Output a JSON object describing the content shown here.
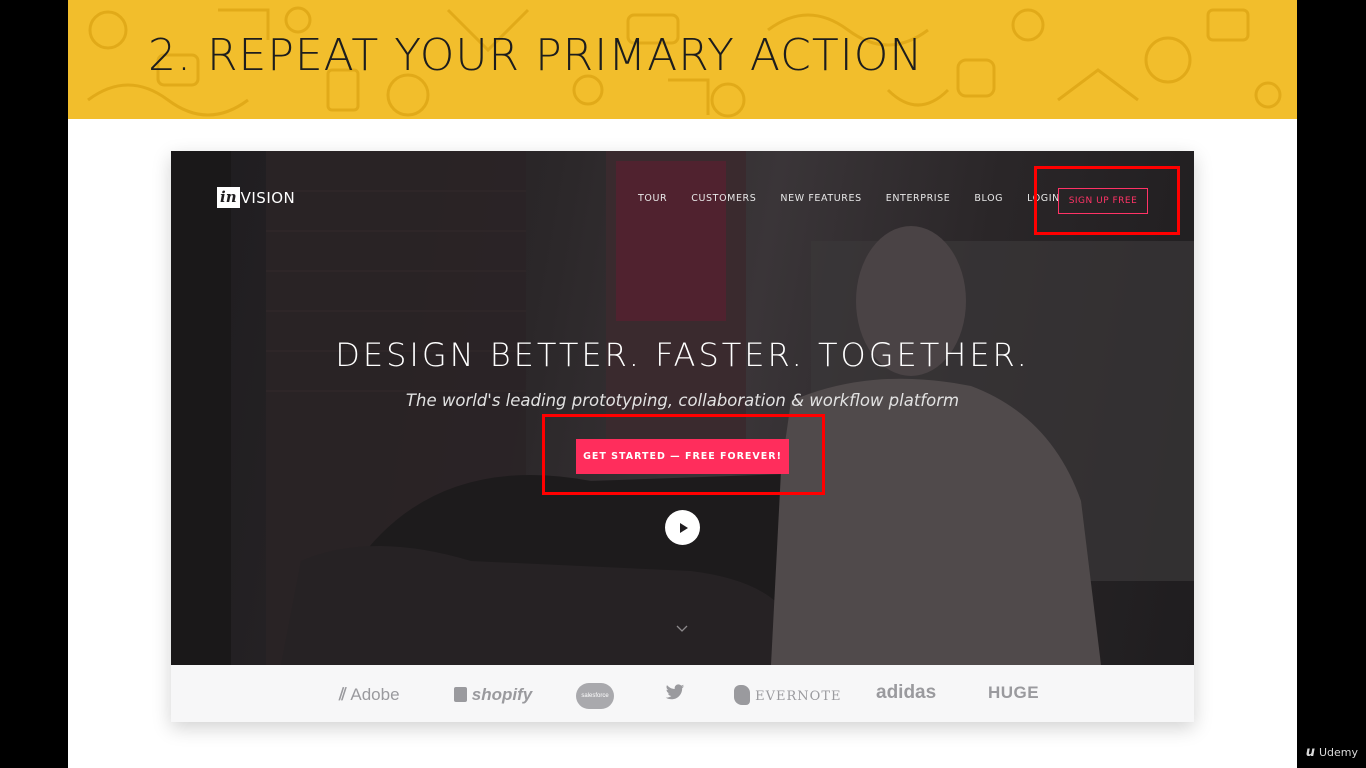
{
  "slide": {
    "title": "2. REPEAT YOUR PRIMARY ACTION",
    "banner_color": "#f2be2c"
  },
  "site": {
    "logo": {
      "box_text": "in",
      "word_text": "VISION"
    },
    "nav": [
      "TOUR",
      "CUSTOMERS",
      "NEW FEATURES",
      "ENTERPRISE",
      "BLOG",
      "LOGIN"
    ],
    "signup_label": "SIGN UP FREE",
    "headline": "DESIGN BETTER. FASTER. TOGETHER.",
    "subhead": "The world's leading prototyping, collaboration & workflow platform",
    "cta_label": "GET STARTED — FREE FOREVER!",
    "accent_color": "#ff2d5c",
    "icons": {
      "play": "play-icon",
      "scroll": "chevron-down-icon"
    },
    "brands": [
      "Adobe",
      "shopify",
      "salesforce",
      "twitter",
      "EVERNOTE",
      "adidas",
      "HUGE"
    ]
  },
  "annotations": {
    "highlight_color": "#ff0000"
  },
  "watermark": {
    "label": "Udemy"
  }
}
